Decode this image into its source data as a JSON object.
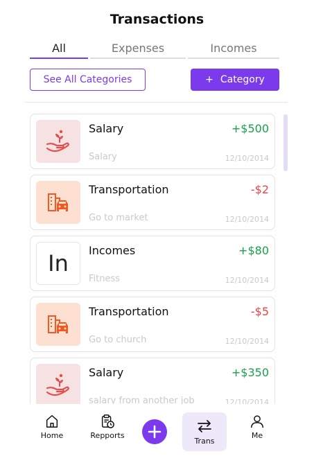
{
  "header": {
    "title": "Transactions"
  },
  "tabs": [
    {
      "label": "All",
      "active": true
    },
    {
      "label": "Expenses",
      "active": false
    },
    {
      "label": "Incomes",
      "active": false
    }
  ],
  "actions": {
    "see_all_label": "See All Categories",
    "add_category_plus": "+",
    "add_category_label": "Category"
  },
  "colors": {
    "accent": "#7c3aed",
    "positive": "#16a34a",
    "negative": "#ef4444"
  },
  "transactions": [
    {
      "name": "Salary",
      "amount": "+$500",
      "note": "Salary",
      "date": "12/10/2014",
      "icon": "hand-coin-icon"
    },
    {
      "name": "Transportation",
      "amount": "-$2",
      "note": "Go to market",
      "date": "12/10/2014",
      "icon": "city-car-icon"
    },
    {
      "name": "Incomes",
      "amount": "+$80",
      "note": "Fitness",
      "date": "12/10/2014",
      "icon": "In"
    },
    {
      "name": "Transportation",
      "amount": "-$5",
      "note": "Go to church",
      "date": "12/10/2014",
      "icon": "city-car-icon"
    },
    {
      "name": "Salary",
      "amount": "+$350",
      "note": "salary from another job",
      "date": "12/10/2014",
      "icon": "hand-coin-icon"
    }
  ],
  "nav": {
    "home": "Home",
    "reports": "Repports",
    "trans": "Trans",
    "me": "Me"
  }
}
